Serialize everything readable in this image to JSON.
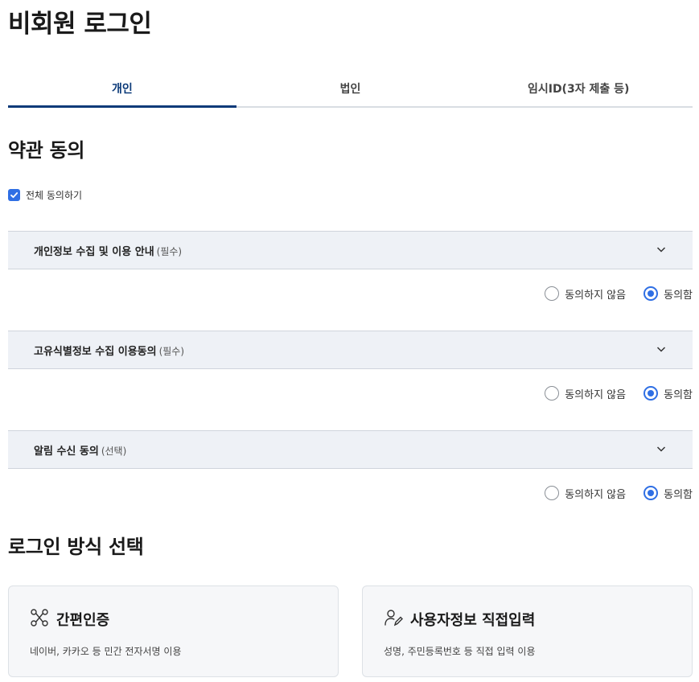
{
  "page": {
    "title": "비회원 로그인"
  },
  "tabs": [
    {
      "label": "개인",
      "active": true
    },
    {
      "label": "법인",
      "active": false
    },
    {
      "label": "임시ID(3자 제출 등)",
      "active": false
    }
  ],
  "terms": {
    "section_title": "약관 동의",
    "agree_all_label": "전체 동의하기",
    "agree_all_checked": true,
    "items": [
      {
        "title": "개인정보 수집 및 이용 안내",
        "tag": "(필수)",
        "disagree_label": "동의하지 않음",
        "agree_label": "동의함",
        "selected": "agree"
      },
      {
        "title": "고유식별정보 수집 이용동의",
        "tag": "(필수)",
        "disagree_label": "동의하지 않음",
        "agree_label": "동의함",
        "selected": "agree"
      },
      {
        "title": "알림 수신 동의",
        "tag": "(선택)",
        "disagree_label": "동의하지 않음",
        "agree_label": "동의함",
        "selected": "agree"
      }
    ]
  },
  "login_methods": {
    "section_title": "로그인 방식 선택",
    "cards": [
      {
        "icon": "simple-auth-icon",
        "title": "간편인증",
        "desc": "네이버, 카카오 등 민간 전자서명 이용"
      },
      {
        "icon": "user-edit-icon",
        "title": "사용자정보 직접입력",
        "desc": "성명, 주민등록번호 등 직접 입력 이용"
      }
    ]
  },
  "colors": {
    "accent": "#2f6fe4",
    "tab_active": "#0b3a79",
    "term_header_bg": "#eef1f6"
  }
}
